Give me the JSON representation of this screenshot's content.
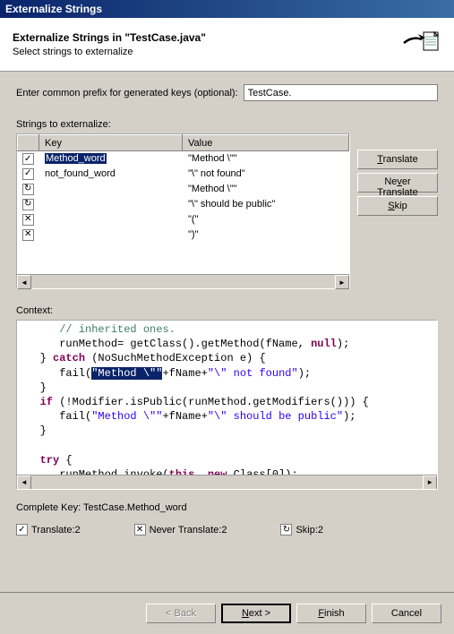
{
  "titlebar": "Externalize Strings",
  "header": {
    "title": "Externalize Strings in \"TestCase.java\"",
    "subtitle": "Select strings to externalize"
  },
  "prefix": {
    "label": "Enter common prefix for generated keys (optional):",
    "value": "TestCase."
  },
  "strings_label": "Strings to externalize:",
  "columns": {
    "key": "Key",
    "value": "Value"
  },
  "rows": [
    {
      "icon": "check",
      "key": "Method_word",
      "value": "\"Method \\\"\"",
      "selected": true
    },
    {
      "icon": "check",
      "key": "not_found_word",
      "value": "\"\\\" not found\""
    },
    {
      "icon": "skip",
      "key": "",
      "value": "\"Method \\\"\""
    },
    {
      "icon": "skip",
      "key": "",
      "value": "\"\\\" should be public\""
    },
    {
      "icon": "cross",
      "key": "",
      "value": "\"(\""
    },
    {
      "icon": "cross",
      "key": "",
      "value": "\")\""
    },
    {
      "icon": "",
      "key": "",
      "value": ""
    }
  ],
  "buttons": {
    "translate": "Translate",
    "never": "Never Translate",
    "skip": "Skip"
  },
  "context_label": "Context:",
  "complete_key": "Complete Key: TestCase.Method_word",
  "status": {
    "translate": "Translate:2",
    "never": "Never Translate:2",
    "skip": "Skip:2"
  },
  "footer": {
    "back": "< Back",
    "next": "Next >",
    "finish": "Finish",
    "cancel": "Cancel"
  }
}
